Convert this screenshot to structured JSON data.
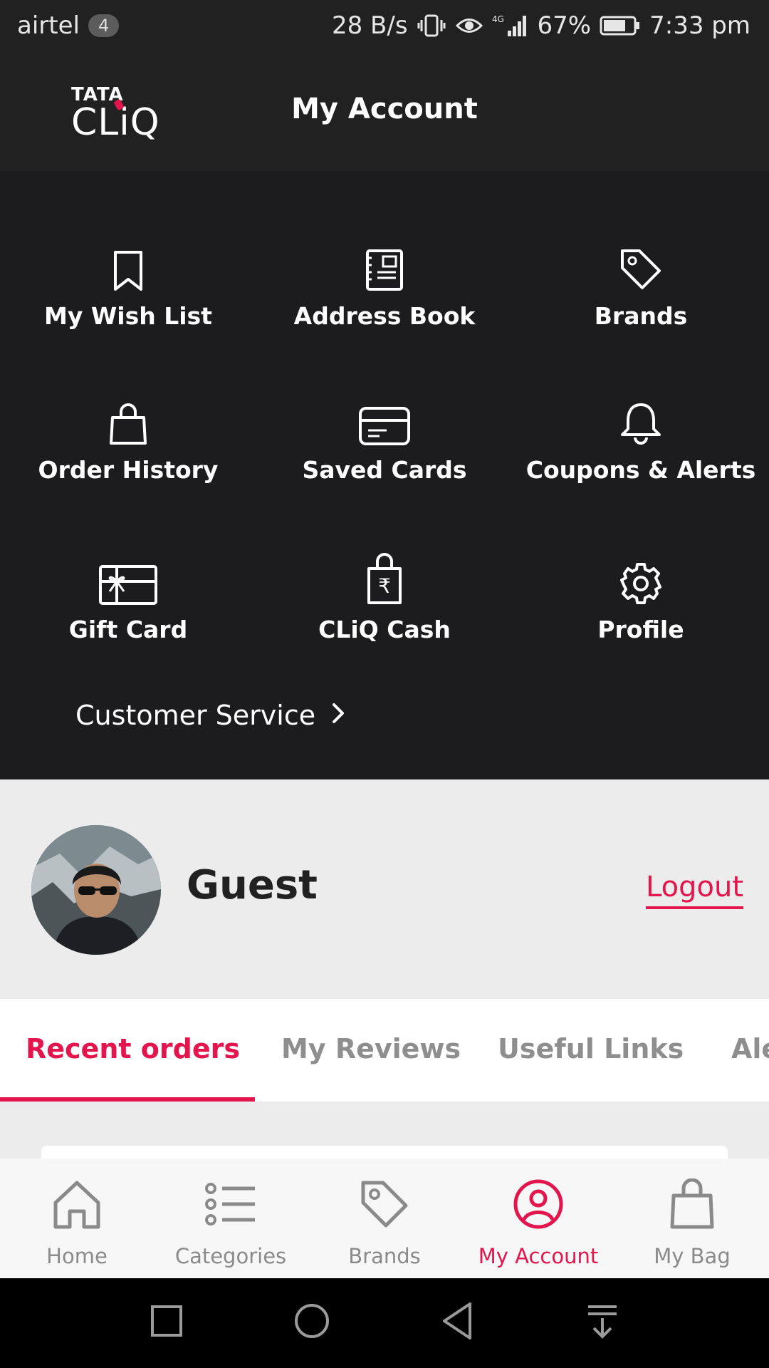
{
  "status_bar": {
    "carrier": "airtel",
    "carrier_badge": "4",
    "speed": "28 B/s",
    "network": "4G",
    "battery": "67%",
    "time": "7:33 pm",
    "icons": [
      "vibrate-icon",
      "eye-icon",
      "signal-icon",
      "battery-icon"
    ]
  },
  "app_bar": {
    "logo_top": "TATA",
    "logo_bottom": "CLiQ",
    "title": "My Account"
  },
  "menu": {
    "items": [
      {
        "label": "My Wish List",
        "icon": "bookmark-icon"
      },
      {
        "label": "Address Book",
        "icon": "address-book-icon"
      },
      {
        "label": "Brands",
        "icon": "tag-icon"
      },
      {
        "label": "Order History",
        "icon": "shopping-bag-icon"
      },
      {
        "label": "Saved Cards",
        "icon": "credit-card-icon"
      },
      {
        "label": "Coupons & Alerts",
        "icon": "bell-icon"
      },
      {
        "label": "Gift Card",
        "icon": "gift-card-icon"
      },
      {
        "label": "CLiQ Cash",
        "icon": "rupee-bag-icon"
      },
      {
        "label": "Profile",
        "icon": "gear-icon"
      }
    ],
    "customer_service": "Customer Service"
  },
  "profile": {
    "name": "Guest",
    "logout": "Logout"
  },
  "tabs": {
    "items": [
      "Recent orders",
      "My Reviews",
      "Useful Links",
      "Alerts"
    ],
    "active_index": 0
  },
  "bottom_nav": {
    "items": [
      {
        "label": "Home",
        "icon": "home-icon"
      },
      {
        "label": "Categories",
        "icon": "list-icon"
      },
      {
        "label": "Brands",
        "icon": "tag-icon"
      },
      {
        "label": "My Account",
        "icon": "account-icon"
      },
      {
        "label": "My Bag",
        "icon": "bag-icon"
      }
    ],
    "active_index": 3
  },
  "colors": {
    "accent": "#e3154c",
    "dark_bg": "#1c1c1e",
    "header_bg": "#212121"
  }
}
